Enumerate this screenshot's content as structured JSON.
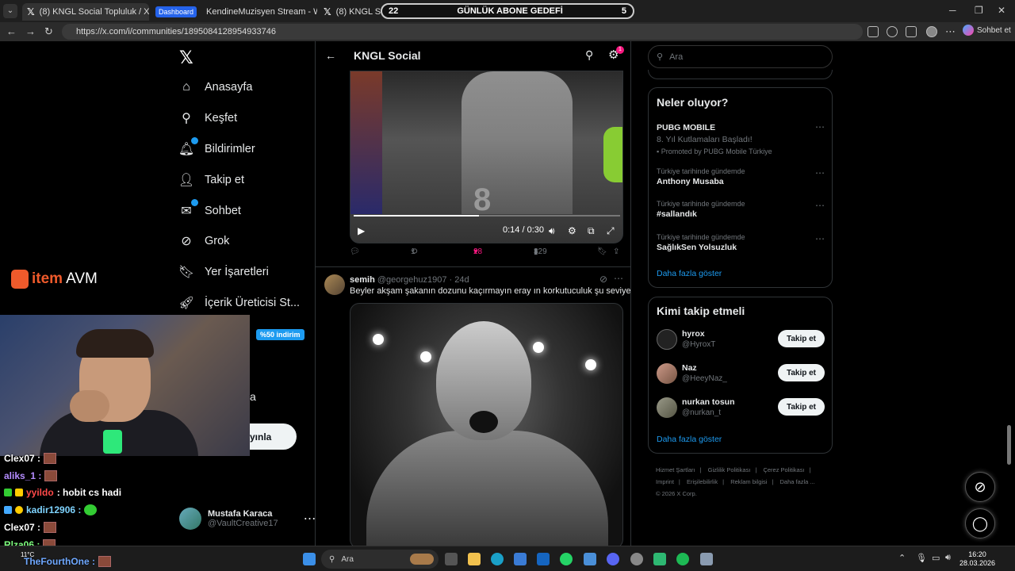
{
  "browser": {
    "tabs": [
      {
        "label": "(8) KNGL Social Topluluk / X"
      },
      {
        "badge": "Dashboard",
        "label": "KendineMuzisyen Stream - Watch"
      },
      {
        "label": "(8) KNGL Social T"
      }
    ],
    "goal_overlay": {
      "left": "22",
      "title": "GÜNLÜK ABONE GEDEFİ",
      "right": "5"
    },
    "url": "https://x.com/i/communities/1895084128954933746",
    "chat_button": "Sohbet et"
  },
  "x_nav": {
    "items": [
      {
        "label": "Anasayfa",
        "icon": "home-icon"
      },
      {
        "label": "Keşfet",
        "icon": "search-icon"
      },
      {
        "label": "Bildirimler",
        "icon": "bell-icon"
      },
      {
        "label": "Takip et",
        "icon": "person-add-icon"
      },
      {
        "label": "Sohbet",
        "icon": "mail-icon"
      },
      {
        "label": "Grok",
        "icon": "grok-icon"
      },
      {
        "label": "Yer İşaretleri",
        "icon": "bookmark-icon"
      },
      {
        "label": "İçerik Üreticisi St...",
        "icon": "rocket-icon"
      }
    ],
    "partial_label": "a",
    "post_button": "yınla",
    "profile": {
      "name": "Mustafa Karaca",
      "handle": "@VaultCreative17"
    }
  },
  "overlay": {
    "brand": {
      "item": "item",
      "avm": "AVM"
    },
    "discount": "%50 indirim",
    "chat": [
      {
        "user": "Clex07 :",
        "color": "#ffffff",
        "msg": ""
      },
      {
        "user": "aliks_1 :",
        "color": "#b48cff",
        "msg": ""
      },
      {
        "user": "yyildo",
        "color": "#ff4a4a",
        "msg": ": hobit cs hadi"
      },
      {
        "user": "kadir12906 :",
        "color": "#7fd4ff",
        "msg": ""
      },
      {
        "user": "Clex07 :",
        "color": "#ffffff",
        "msg": ""
      },
      {
        "user": "Rlza06 :",
        "color": "#7fff7f",
        "msg": ""
      },
      {
        "user": "TheFourthOne :",
        "color": "#6fa8ff",
        "msg": ""
      }
    ]
  },
  "center": {
    "title": "KNGL Social",
    "notif_count": "1",
    "video": {
      "time": "0:14 / 0:30",
      "progress": 0.47
    },
    "actions": {
      "reply": "",
      "retweet": "1",
      "like": "28",
      "views": "329"
    },
    "tweet2": {
      "name": "semih",
      "handle": "@georgehuz1907 · 24d",
      "text": "Beyler akşam şakanın dozunu kaçırmayın eray ın korkutuculuk şu seviye de"
    }
  },
  "right": {
    "search_placeholder": "Ara",
    "trends_title": "Neler oluyor?",
    "trends": [
      {
        "ctx": "",
        "title": "PUBG MOBILE",
        "sub": "8. Yıl Kutlamaları Başladı!",
        "promo": "Promoted by PUBG Mobile Türkiye"
      },
      {
        "ctx": "Türkiye tarihinde gündemde",
        "title": "Anthony Musaba"
      },
      {
        "ctx": "Türkiye tarihinde gündemde",
        "title": "#sallandık"
      },
      {
        "ctx": "Türkiye tarihinde gündemde",
        "title": "SağlıkSen Yolsuzluk"
      }
    ],
    "show_more": "Daha fazla göster",
    "who_title": "Kimi takip etmeli",
    "who": [
      {
        "name": "hyrox",
        "handle": "@HyroxT",
        "btn": "Takip et"
      },
      {
        "name": "Naz",
        "handle": "@HeeyNaz_",
        "btn": "Takip et"
      },
      {
        "name": "nurkan tosun",
        "handle": "@nurkan_t",
        "btn": "Takip et"
      }
    ],
    "footer": [
      "Hizmet Şartları",
      "|",
      "Gizlilik Politikası",
      "|",
      "Çerez Politikası",
      "|",
      "Imprint",
      "|",
      "Erişilebilirlik",
      "|",
      "Reklam bilgisi",
      "|",
      "Daha fazla ...",
      "© 2026 X Corp."
    ]
  },
  "taskbar": {
    "search": "Ara",
    "weather": "11°C",
    "time": "16:20",
    "date": "28.03.2026"
  }
}
